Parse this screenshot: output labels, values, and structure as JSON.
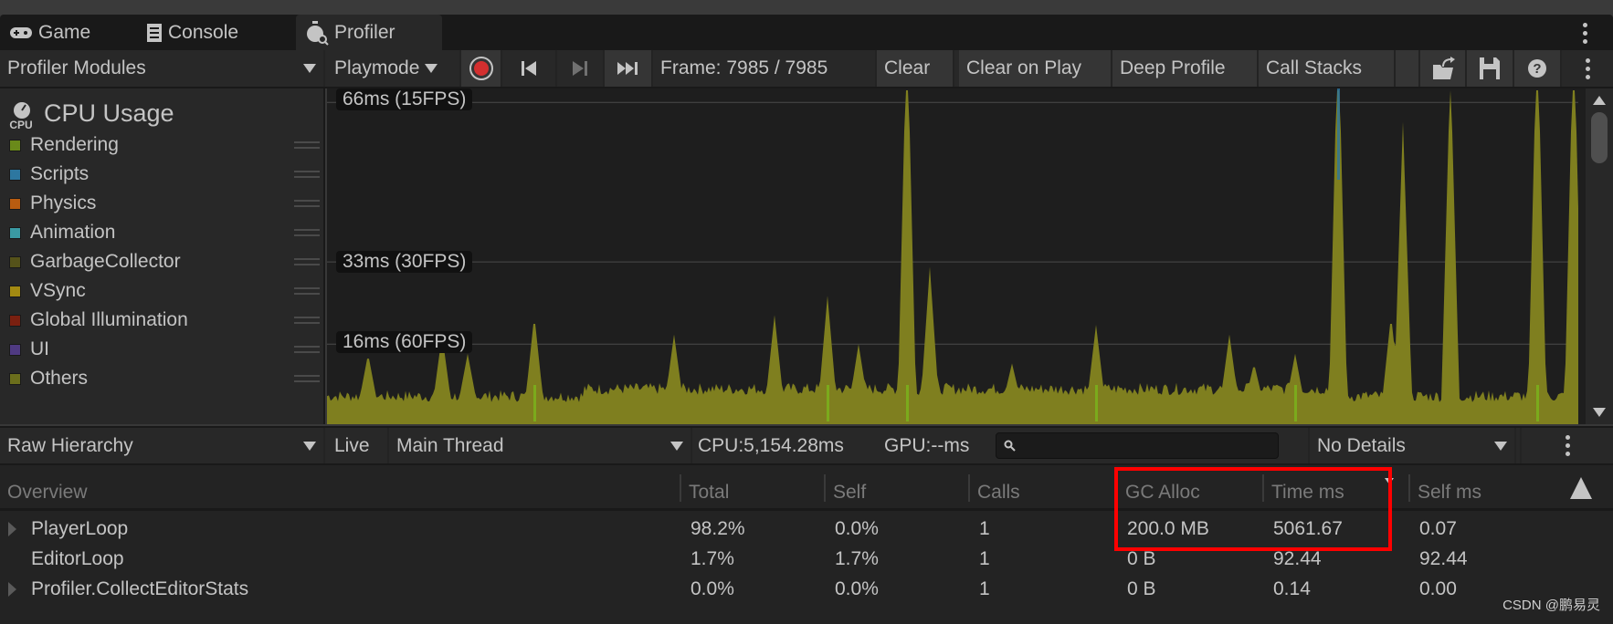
{
  "tabs": [
    {
      "label": "Game",
      "icon": "gamepad-icon"
    },
    {
      "label": "Console",
      "icon": "console-icon"
    },
    {
      "label": "Profiler",
      "icon": "stopwatch-icon",
      "active": true
    }
  ],
  "toolbar": {
    "modules": "Profiler Modules",
    "mode": "Playmode",
    "frame": "Frame: 7985 / 7985",
    "clear": "Clear",
    "clear_on_play": "Clear on Play",
    "deep_profile": "Deep Profile",
    "call_stacks": "Call Stacks"
  },
  "module": {
    "icon_text": "CPU",
    "title": "CPU Usage",
    "legend": [
      {
        "label": "Rendering",
        "color": "#6a8a1a"
      },
      {
        "label": "Scripts",
        "color": "#2d77a0"
      },
      {
        "label": "Physics",
        "color": "#b85c10"
      },
      {
        "label": "Animation",
        "color": "#3a9aa3"
      },
      {
        "label": "GarbageCollector",
        "color": "#55521a"
      },
      {
        "label": "VSync",
        "color": "#a38a12"
      },
      {
        "label": "Global Illumination",
        "color": "#7a2010"
      },
      {
        "label": "UI",
        "color": "#4f3a82"
      },
      {
        "label": "Others",
        "color": "#6b6e1c"
      }
    ]
  },
  "chart": {
    "guides": [
      "66ms (15FPS)",
      "33ms (30FPS)",
      "16ms (60FPS)"
    ],
    "fill_color": "#7f7f1f",
    "accent_color": "#7ab51c",
    "scripts_color": "#2d77a0"
  },
  "lower": {
    "view": "Raw Hierarchy",
    "live": "Live",
    "thread": "Main Thread",
    "cpu": "CPU:5,154.28ms",
    "gpu": "GPU:--ms",
    "search_placeholder": "",
    "details": "No Details"
  },
  "table": {
    "columns": [
      "Overview",
      "Total",
      "Self",
      "Calls",
      "GC Alloc",
      "Time ms",
      "Self ms"
    ],
    "rows": [
      {
        "name": "PlayerLoop",
        "expandable": true,
        "cells": [
          "98.2%",
          "0.0%",
          "1",
          "200.0 MB",
          "5061.67",
          "0.07"
        ]
      },
      {
        "name": "EditorLoop",
        "expandable": false,
        "cells": [
          "1.7%",
          "1.7%",
          "1",
          "0 B",
          "92.44",
          "92.44"
        ]
      },
      {
        "name": "Profiler.CollectEditorStats",
        "expandable": true,
        "cells": [
          "0.0%",
          "0.0%",
          "1",
          "0 B",
          "0.14",
          "0.00"
        ]
      }
    ]
  },
  "watermark": "CSDN @鹏易灵",
  "highlight_color": "#ff0000"
}
